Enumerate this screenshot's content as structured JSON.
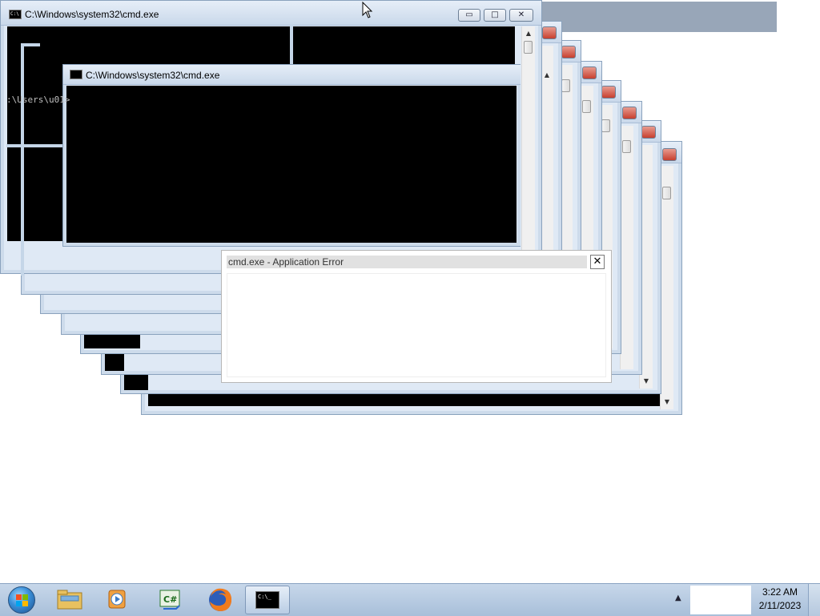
{
  "windows": {
    "back_title": "C:\\Windows\\system32\\cmd.exe",
    "front_title": "C:\\Windows\\system32\\cmd.exe",
    "front_prompt": ":\\Users\\u01>",
    "minimize_glyph": "▭",
    "maximize_glyph": "□",
    "close_glyph": "✕"
  },
  "dialog": {
    "title": "cmd.exe - Application Error",
    "close_glyph": "✕"
  },
  "taskbar": {
    "pinned": [
      {
        "name": "windows-explorer",
        "icon": "folder-icon"
      },
      {
        "name": "media-player",
        "icon": "media-player-icon"
      },
      {
        "name": "csharp-editor",
        "icon": "csharp-icon"
      },
      {
        "name": "firefox",
        "icon": "firefox-icon"
      },
      {
        "name": "cmd",
        "icon": "cmd-icon",
        "active": true
      }
    ],
    "cmd_icon_text": "C:\\_",
    "csharp_label": "C#",
    "tray_arrow": "▲",
    "clock_time": "3:22 AM",
    "clock_date": "2/11/2023"
  },
  "colors": {
    "console": "#000000",
    "taskbar": "#b6c9df",
    "window_frame": "#c5d6e8"
  }
}
